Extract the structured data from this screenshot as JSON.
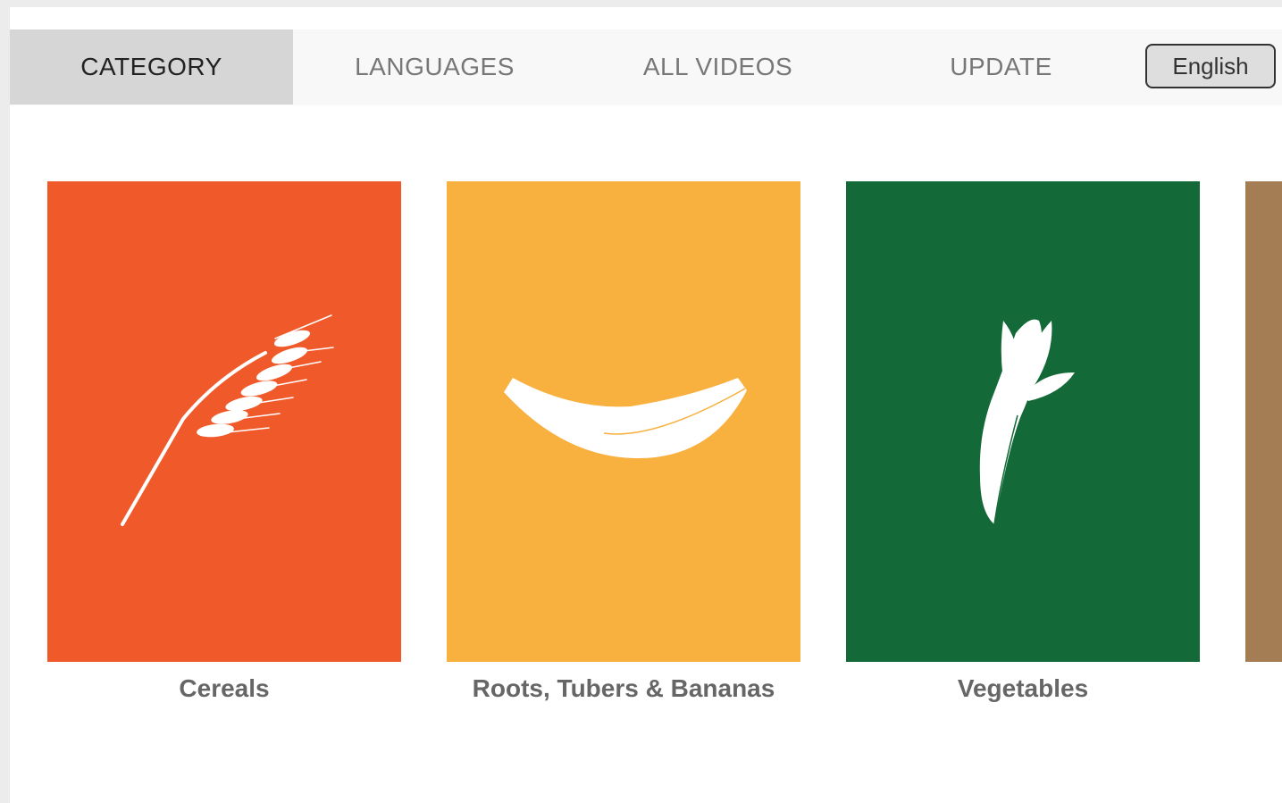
{
  "tabs": [
    {
      "label": "CATEGORY",
      "active": true
    },
    {
      "label": "LANGUAGES",
      "active": false
    },
    {
      "label": "ALL VIDEOS",
      "active": false
    },
    {
      "label": "UPDATE",
      "active": false
    }
  ],
  "language_button": {
    "label": "English"
  },
  "categories": [
    {
      "label": "Cereals",
      "color": "#f05a2b",
      "icon": "wheat-icon"
    },
    {
      "label": "Roots, Tubers & Bananas",
      "color": "#f8b03f",
      "icon": "banana-icon"
    },
    {
      "label": "Vegetables",
      "color": "#136a38",
      "icon": "carrot-icon"
    },
    {
      "label": "",
      "color": "#a57d55",
      "icon": ""
    }
  ]
}
